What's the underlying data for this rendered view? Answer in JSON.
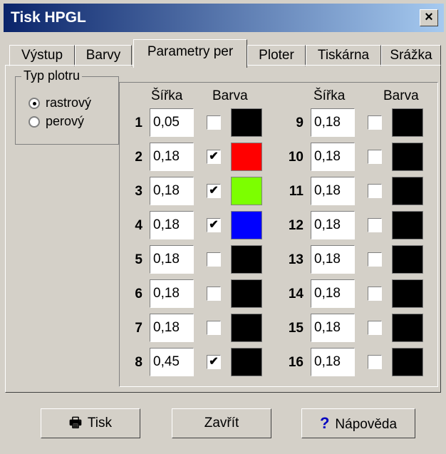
{
  "window": {
    "title": "Tisk HPGL",
    "close_label": "×"
  },
  "tabs": [
    "Výstup",
    "Barvy",
    "Parametry per",
    "Ploter",
    "Tiskárna",
    "Srážka"
  ],
  "plot_type": {
    "legend": "Typ plotru",
    "options": [
      "rastrový",
      "perový"
    ],
    "selected": "rastrový"
  },
  "columns": {
    "width": "Šířka",
    "color": "Barva"
  },
  "pens": [
    {
      "n": "1",
      "w": "0,05",
      "checked": false,
      "color": "#000000"
    },
    {
      "n": "2",
      "w": "0,18",
      "checked": true,
      "color": "#ff0000"
    },
    {
      "n": "3",
      "w": "0,18",
      "checked": true,
      "color": "#7cff00"
    },
    {
      "n": "4",
      "w": "0,18",
      "checked": true,
      "color": "#0000ff"
    },
    {
      "n": "5",
      "w": "0,18",
      "checked": false,
      "color": "#000000"
    },
    {
      "n": "6",
      "w": "0,18",
      "checked": false,
      "color": "#000000"
    },
    {
      "n": "7",
      "w": "0,18",
      "checked": false,
      "color": "#000000"
    },
    {
      "n": "8",
      "w": "0,45",
      "checked": true,
      "color": "#000000"
    },
    {
      "n": "9",
      "w": "0,18",
      "checked": false,
      "color": "#000000"
    },
    {
      "n": "10",
      "w": "0,18",
      "checked": false,
      "color": "#000000"
    },
    {
      "n": "11",
      "w": "0,18",
      "checked": false,
      "color": "#000000"
    },
    {
      "n": "12",
      "w": "0,18",
      "checked": false,
      "color": "#000000"
    },
    {
      "n": "13",
      "w": "0,18",
      "checked": false,
      "color": "#000000"
    },
    {
      "n": "14",
      "w": "0,18",
      "checked": false,
      "color": "#000000"
    },
    {
      "n": "15",
      "w": "0,18",
      "checked": false,
      "color": "#000000"
    },
    {
      "n": "16",
      "w": "0,18",
      "checked": false,
      "color": "#000000"
    }
  ],
  "buttons": {
    "print": "Tisk",
    "close": "Zavřít",
    "help": "Nápověda"
  }
}
